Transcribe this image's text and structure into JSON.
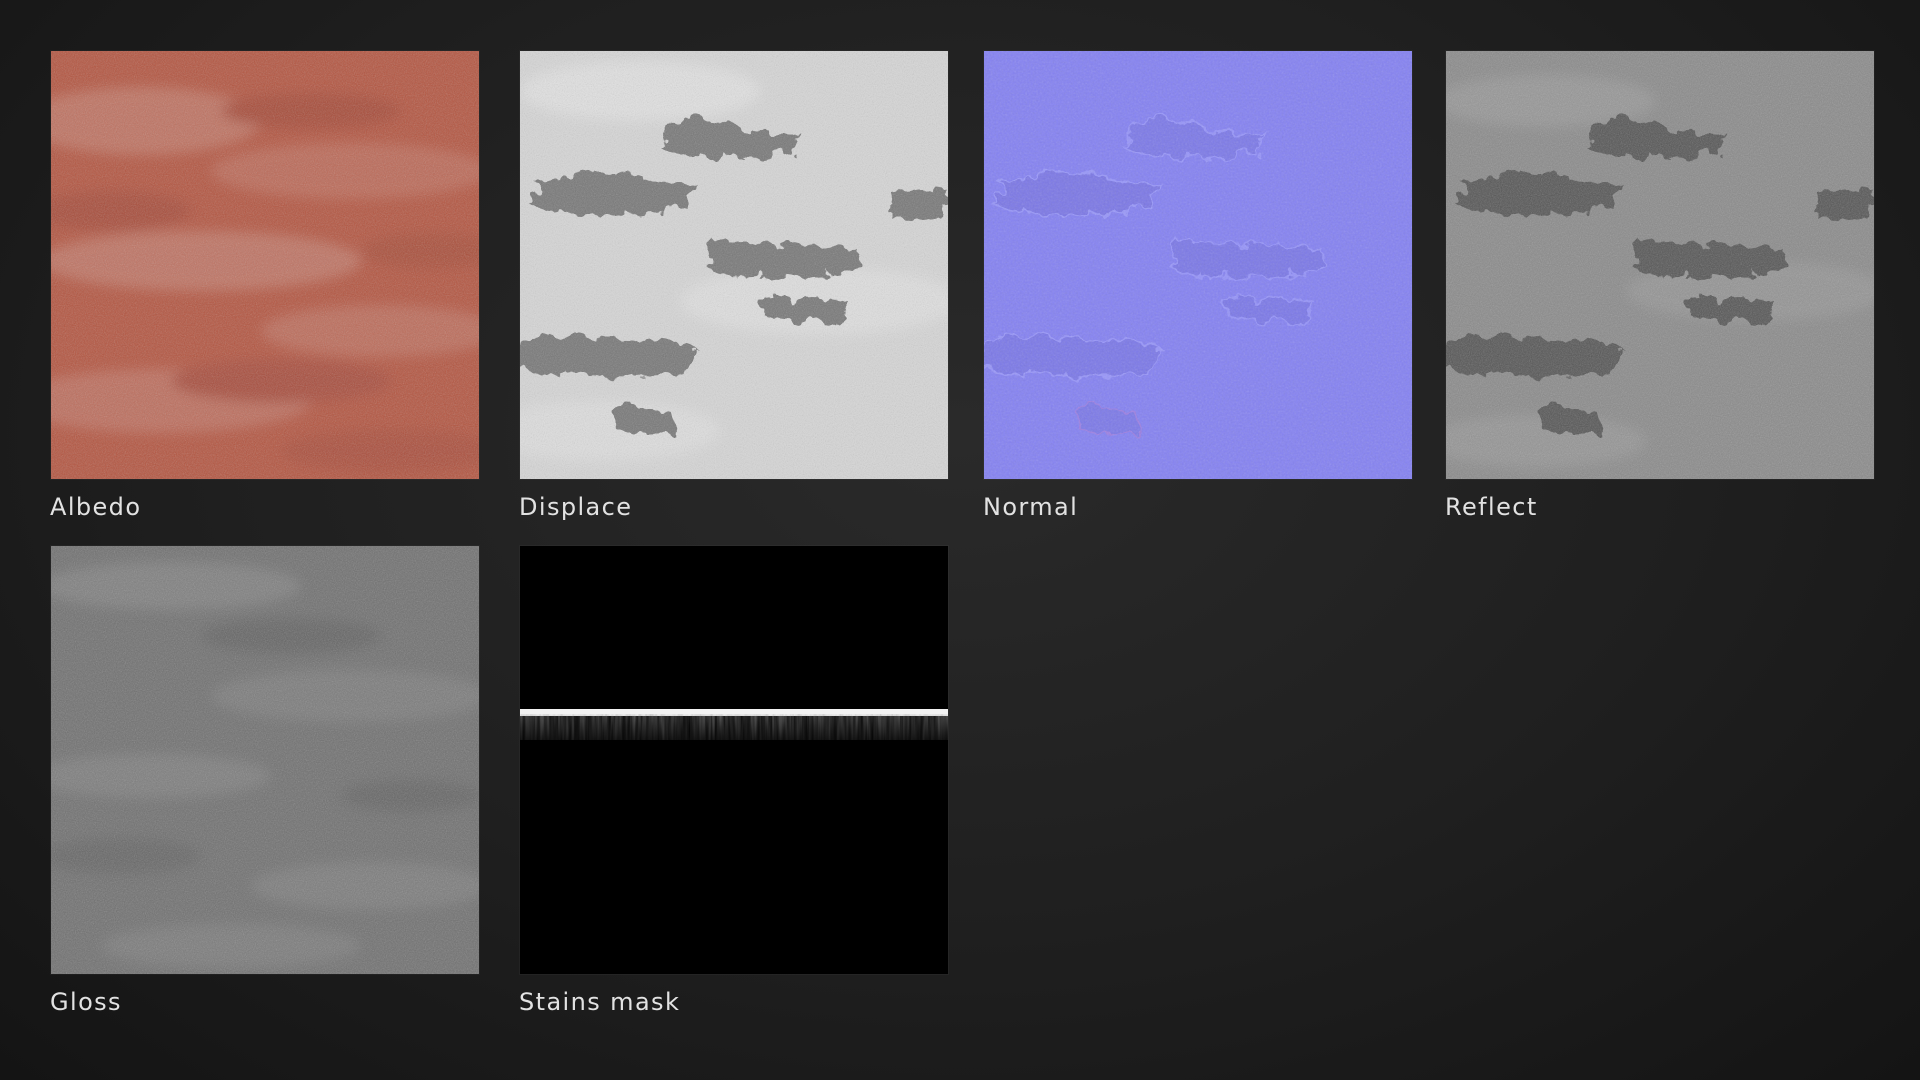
{
  "maps": [
    {
      "label": "Albedo"
    },
    {
      "label": "Displace"
    },
    {
      "label": "Normal"
    },
    {
      "label": "Reflect"
    },
    {
      "label": "Gloss"
    },
    {
      "label": "Stains mask"
    }
  ]
}
